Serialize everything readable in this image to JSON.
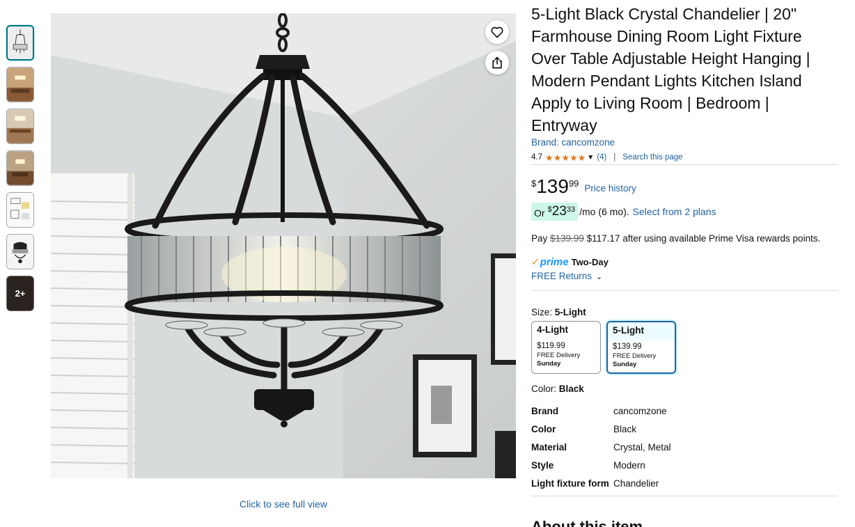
{
  "thumbnails": {
    "more_label": "2+"
  },
  "image": {
    "full_view_label": "Click to see full view"
  },
  "product": {
    "title": "5-Light Black Crystal Chandelier | 20\" Farmhouse Dining Room Light Fixture Over Table Adjustable Height Hanging | Modern Pendant Lights Kitchen Island Apply to Living Room | Bedroom | Entryway",
    "brand_link": "Brand: cancomzone",
    "rating": "4.7",
    "rating_count": "(4)",
    "search_page": "Search this page"
  },
  "price": {
    "symbol": "$",
    "whole": "139",
    "fraction": "99",
    "history_label": "Price history"
  },
  "monthly": {
    "or": "Or",
    "symbol": "$",
    "whole": "23",
    "fraction": "33",
    "term": "/mo (6 mo).",
    "plans_label": "Select from 2 plans"
  },
  "pay": {
    "prefix": "Pay",
    "original": "$139.99",
    "discounted": "$117.17",
    "suffix": "after using available Prime Visa rewards points."
  },
  "delivery": {
    "prime_label": "prime",
    "speed": "Two-Day",
    "returns_label": "FREE Returns"
  },
  "size": {
    "label": "Size:",
    "selected": "5-Light",
    "options": [
      {
        "name": "4-Light",
        "price": "$119.99",
        "delivery": "FREE Delivery",
        "day": "Sunday"
      },
      {
        "name": "5-Light",
        "price": "$139.99",
        "delivery": "FREE Delivery",
        "day": "Sunday"
      }
    ]
  },
  "color": {
    "label": "Color:",
    "selected": "Black"
  },
  "specs": [
    {
      "key": "Brand",
      "value": "cancomzone"
    },
    {
      "key": "Color",
      "value": "Black"
    },
    {
      "key": "Material",
      "value": "Crystal, Metal"
    },
    {
      "key": "Style",
      "value": "Modern"
    },
    {
      "key": "Light fixture form",
      "value": "Chandelier"
    }
  ],
  "about_heading": "About this item",
  "colors": {
    "link": "#2162a1",
    "star": "#de7921",
    "prime_blue": "#1399ff",
    "monthly_bg": "#cdf7e6"
  }
}
